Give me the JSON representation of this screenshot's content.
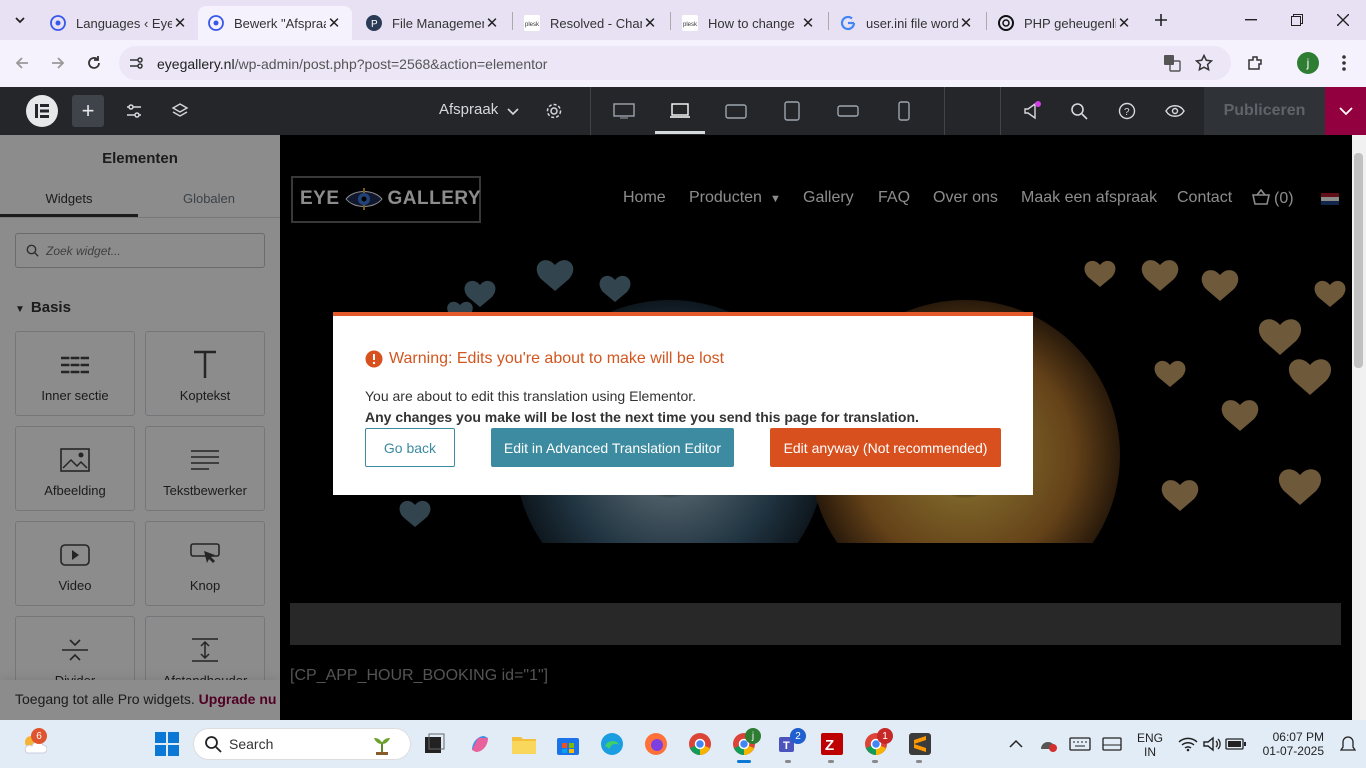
{
  "browser": {
    "tabs": [
      {
        "title": "Languages ‹ Eye",
        "active": false,
        "favicon": "wordpress-icon"
      },
      {
        "title": "Bewerk \"Afspraa",
        "active": true,
        "favicon": "wordpress-icon"
      },
      {
        "title": "File Managemen",
        "active": false,
        "favicon": "plesk-p-icon"
      },
      {
        "title": "Resolved - Chan",
        "active": false,
        "favicon": "plesk-icon"
      },
      {
        "title": "How to change",
        "active": false,
        "favicon": "plesk-icon"
      },
      {
        "title": "user.ini file word",
        "active": false,
        "favicon": "google-icon"
      },
      {
        "title": "PHP geheugenli",
        "active": false,
        "favicon": "openai-icon"
      }
    ],
    "url_host": "eyegallery.nl",
    "url_path": "/wp-admin/post.php?post=2568&action=elementor",
    "profile_initial": "j"
  },
  "elementor": {
    "page_name": "Afspraak",
    "publish_label": "Publiceren",
    "panel_title": "Elementen",
    "tabs": [
      "Widgets",
      "Globalen"
    ],
    "search_placeholder": "Zoek widget...",
    "category": "Basis",
    "widgets": [
      {
        "label": "Inner sectie",
        "icon": "inner-section-icon"
      },
      {
        "label": "Koptekst",
        "icon": "heading-icon"
      },
      {
        "label": "Afbeelding",
        "icon": "image-icon"
      },
      {
        "label": "Tekstbewerker",
        "icon": "text-editor-icon"
      },
      {
        "label": "Video",
        "icon": "video-icon"
      },
      {
        "label": "Knop",
        "icon": "button-icon"
      },
      {
        "label": "Divider",
        "icon": "divider-icon"
      },
      {
        "label": "Afstandhouder",
        "icon": "spacer-icon"
      }
    ],
    "pro_text": "Toegang tot alle Pro widgets.",
    "pro_link": "Upgrade nu"
  },
  "site": {
    "logo_text_left": "EYE",
    "logo_text_right": "GALLERY",
    "nav": [
      "Home",
      "Producten",
      "Gallery",
      "FAQ",
      "Over ons",
      "Maak een afspraak",
      "Contact"
    ],
    "cart": "(0)",
    "shortcode": "[CP_APP_HOUR_BOOKING id=\"1\"]"
  },
  "dialog": {
    "title": "Warning: Edits you're about to make will be lost",
    "body": "You are about to edit this translation using Elementor.",
    "body_bold": "Any changes you make will be lost the next time you send this page for translation.",
    "btn_back": "Go back",
    "btn_ate": "Edit in Advanced Translation Editor",
    "btn_anyway": "Edit anyway (Not recommended)"
  },
  "taskbar": {
    "search_label": "Search",
    "weather_badge": "6",
    "teams_badge": "2",
    "chrome2_badge": "1",
    "lang_top": "ENG",
    "lang_bottom": "IN",
    "time": "06:07 PM",
    "date": "01-07-2025"
  },
  "colors": {
    "accent_warning": "#e35b2b",
    "ate_button": "#3d8ba0",
    "anyway_button": "#d9501f",
    "elementor_brand": "#93003f"
  }
}
